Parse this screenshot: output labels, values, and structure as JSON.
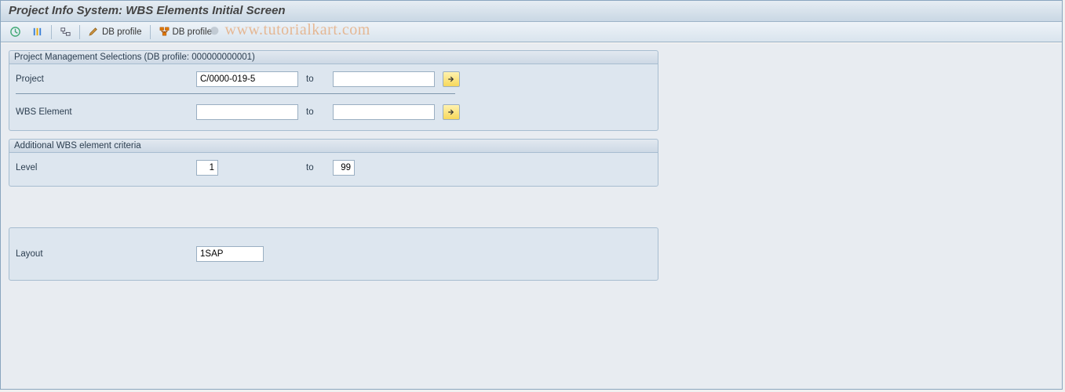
{
  "title": "Project Info System: WBS Elements Initial Screen",
  "watermark": "www.tutorialkart.com",
  "toolbar": {
    "db_profile_edit": "DB profile",
    "db_profile_choose": "DB profile"
  },
  "groups": {
    "selections": {
      "title": "Project Management Selections (DB profile: 000000000001)",
      "project": {
        "label": "Project",
        "from": "C/0000-019-5",
        "to_label": "to",
        "to": ""
      },
      "wbs": {
        "label": "WBS Element",
        "from": "",
        "to_label": "to",
        "to": ""
      }
    },
    "additional": {
      "title": "Additional WBS element criteria",
      "level": {
        "label": "Level",
        "from": "1",
        "to_label": "to",
        "to": "99"
      }
    },
    "layoutg": {
      "layout": {
        "label": "Layout",
        "value": "1SAP"
      }
    }
  }
}
